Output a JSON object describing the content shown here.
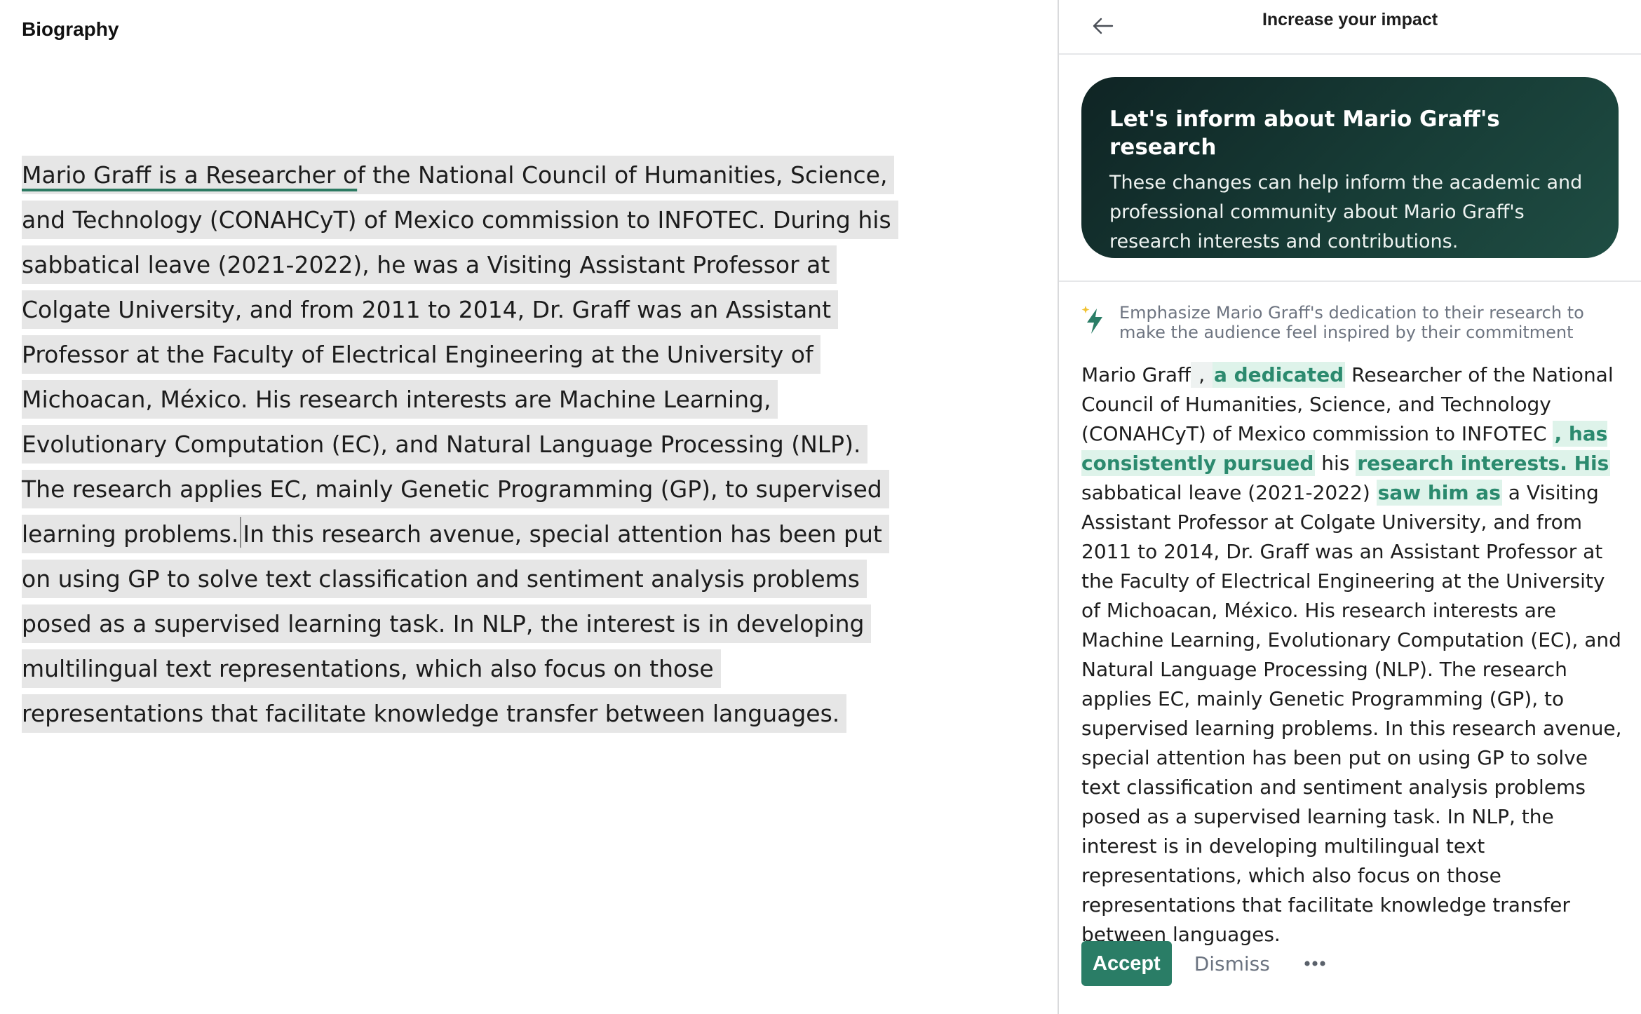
{
  "document": {
    "title": "Biography",
    "body": {
      "part1": "Mario Graff is a Researcher o",
      "part2": "f the National Council of Humanities, Science, and Technology (CONAHCyT) of Mexico commission to INFOTEC. During his sabbatical leave (2021-2022), he was a Visiting Assistant Professor at Colgate University, and from 2011 to 2014, Dr. Graff was an Assistant Professor at the Faculty of Electrical Engineering at the University of Michoacan, México. His research interests are Machine Learning, Evolutionary Computation (EC), and Natural Language Processing (NLP). The research applies EC, mainly Genetic Programming (GP), to supervised learning problems.",
      "part3": "In this research avenue, special attention has been put on using GP to solve text classification and sentiment analysis problems posed as a supervised learning task. In NLP, the interest is in developing multilingual text representations, which also focus on those representations that facilitate knowledge transfer between languages."
    }
  },
  "panel": {
    "title": "Increase your impact",
    "back_icon": "arrow-left-icon",
    "card": {
      "heading": "Let's inform about Mario Graff's research",
      "description": "These changes can help inform the academic and professional community about Mario Graff's research interests and contributions."
    },
    "suggestion": {
      "icon": "lightning-bolt-icon",
      "hint": "Emphasize Mario Graff's dedication to their research to make the audience feel inspired by their commitment",
      "segments": {
        "s1": "Mario Graff",
        "s2": " , ",
        "s3": "a dedicated",
        "s4": " Researcher of the National Council of Humanities, Science, and Technology (CONAHCyT) of Mexico commission to INFOTEC ",
        "s5": ", has consistently pursued",
        "s6": " his ",
        "s7": "research interests. His",
        "s8": " sabbatical leave (2021-2022) ",
        "s9": "saw him as",
        "s10": " a Visiting Assistant Professor at Colgate University, and from 2011 to 2014, Dr. Graff was an Assistant Professor at the Faculty of Electrical Engineering at the University of Michoacan, México. His research interests are Machine Learning, Evolutionary Computation (EC), and Natural Language Processing (NLP). The research applies EC, mainly Genetic Programming (GP), to supervised learning problems. In this research avenue, special attention has been put on using GP to solve text classification and sentiment analysis problems posed as a supervised learning task. In NLP, the interest is in developing multilingual text representations, which also focus on those representations that facilitate knowledge transfer between languages."
      }
    },
    "actions": {
      "accept_label": "Accept",
      "dismiss_label": "Dismiss",
      "more_icon": "more-horizontal-icon"
    }
  },
  "colors": {
    "accent": "#2a7d66",
    "card_dark": "#173c36",
    "insert_bg": "#def3ea",
    "insert_text": "#2b8a6e",
    "doc_highlight": "#e6e6e6"
  }
}
